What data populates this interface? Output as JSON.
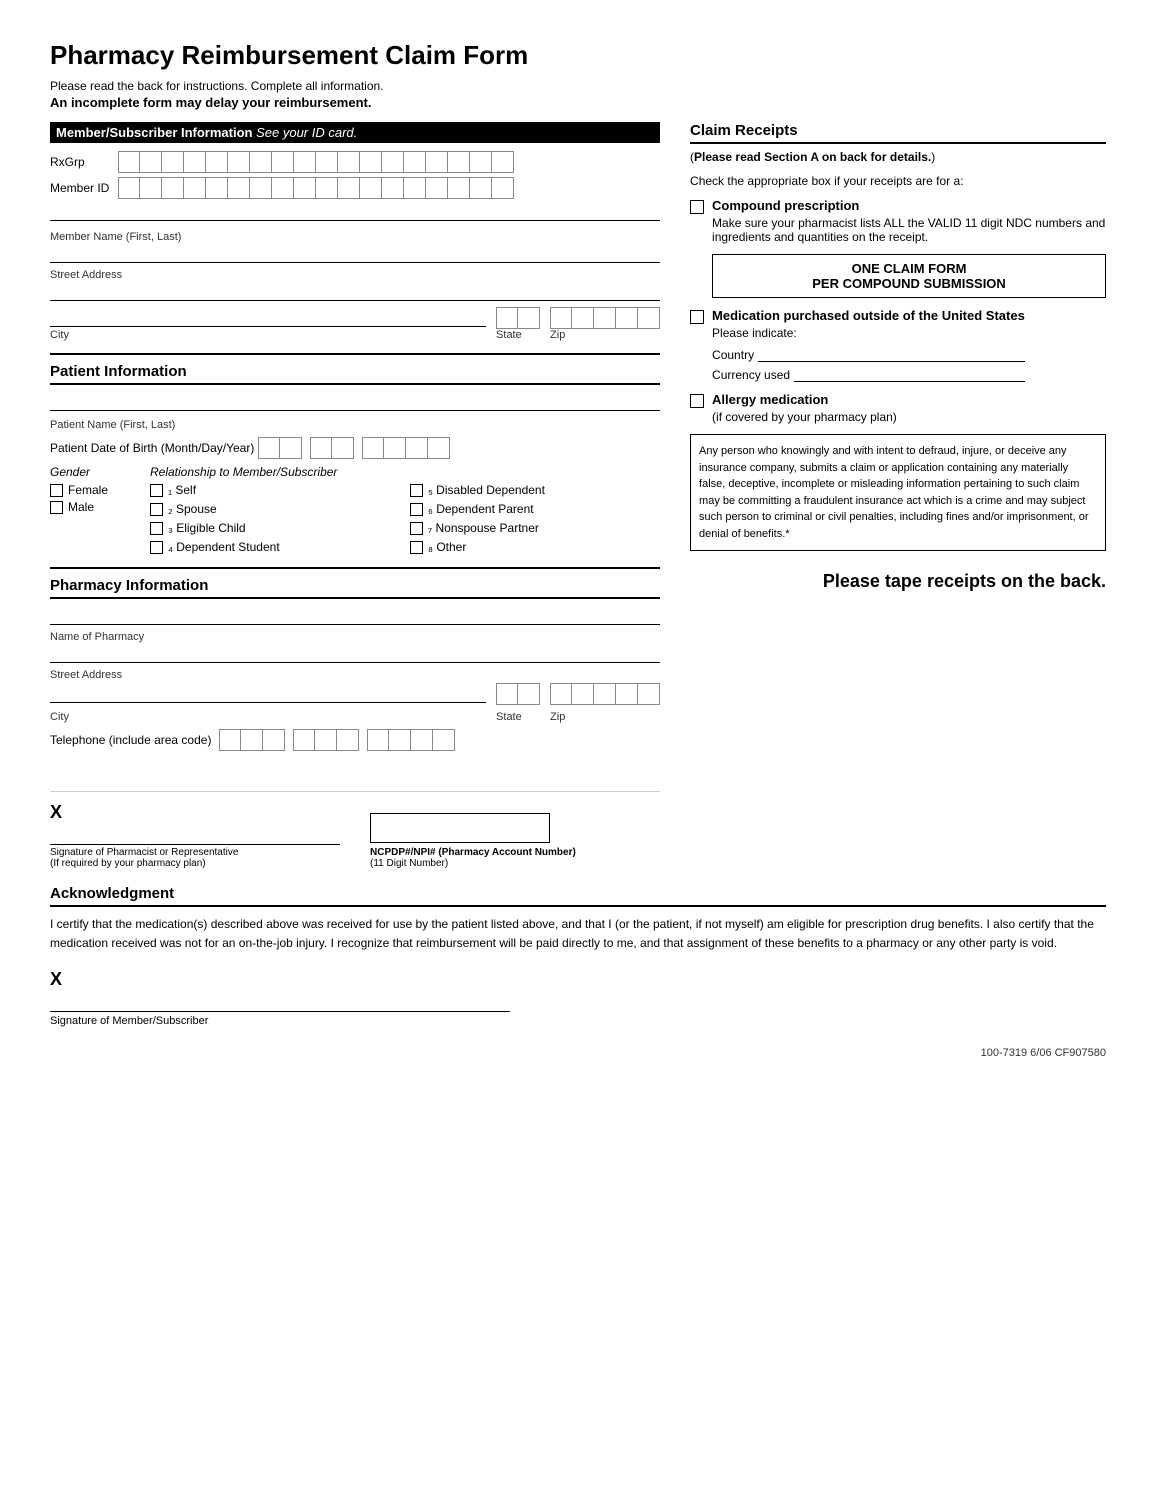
{
  "title": "Pharmacy Reimbursement Claim Form",
  "subtitle1": "Please read the back for instructions. Complete all information.",
  "subtitle2": "An incomplete form may delay your reimbursement.",
  "member_section": {
    "header": "Member/Subscriber Information",
    "header_italic": "See your ID card.",
    "rxgrp_label": "RxGrp",
    "member_id_label": "Member ID",
    "member_name_label": "Member Name (First, Last)",
    "street_address_label": "Street Address",
    "city_label": "City",
    "state_label": "State",
    "zip_label": "Zip"
  },
  "patient_section": {
    "header": "Patient Information",
    "name_label": "Patient Name (First, Last)",
    "dob_label": "Patient Date of Birth (Month/Day/Year)",
    "gender_label": "Gender",
    "rel_label": "Relationship to Member/Subscriber",
    "gender_options": [
      "Female",
      "Male"
    ],
    "rel_options": [
      {
        "num": "1",
        "text": "Self"
      },
      {
        "num": "2",
        "text": "Spouse"
      },
      {
        "num": "3",
        "text": "Eligible Child"
      },
      {
        "num": "4",
        "text": "Dependent Student"
      },
      {
        "num": "5",
        "text": "Disabled Dependent"
      },
      {
        "num": "6",
        "text": "Dependent Parent"
      },
      {
        "num": "7",
        "text": "Nonspouse Partner"
      },
      {
        "num": "8",
        "text": "Other"
      }
    ]
  },
  "pharmacy_section": {
    "header": "Pharmacy Information",
    "name_label": "Name of Pharmacy",
    "street_label": "Street Address",
    "city_label": "City",
    "state_label": "State",
    "zip_label": "Zip",
    "tel_label": "Telephone (include area code)"
  },
  "claim_receipts": {
    "title": "Claim Receipts",
    "subtitle": "(Please read Section A on back for details.)",
    "check_text": "Check the appropriate box if your receipts are for a:",
    "items": [
      {
        "id": "compound",
        "title": "Compound prescription",
        "text": "Make sure your pharmacist lists ALL the VALID 11 digit NDC numbers and ingredients and quantities on the receipt."
      },
      {
        "id": "medication-outside",
        "title": "Medication purchased outside of the United States",
        "text": "Please indicate:",
        "country_label": "Country",
        "currency_label": "Currency used"
      },
      {
        "id": "allergy",
        "title": "Allergy medication",
        "text": "(if covered by your pharmacy plan)"
      }
    ],
    "one_claim_label1": "ONE CLAIM FORM",
    "one_claim_label2": "PER COMPOUND SUBMISSION"
  },
  "fraud_text": "Any person who knowingly and with intent to defraud, injure, or deceive any insurance company, submits a claim or application containing any materially false, deceptive, incomplete or misleading information pertaining to such claim may be committing a fraudulent insurance act which is a crime and may subject such person to criminal or civil penalties, including fines and/or imprisonment, or denial of benefits.*",
  "tape_receipts": "Please tape receipts on the back.",
  "signature": {
    "x_label": "X",
    "sig_line_label": "Signature of Pharmacist or Representative",
    "sig_line_sublabel": "(If required by your pharmacy plan)",
    "ncpdp_label": "NCPDP#/NPI# (Pharmacy Account Number)",
    "ncpdp_sublabel": "(11 Digit Number)"
  },
  "acknowledgment": {
    "title": "Acknowledgment",
    "text": "I certify that the medication(s) described above was received for use by the patient listed above, and that I (or the patient, if not myself) am eligible for prescription drug benefits. I also certify that the medication received was not for an on-the-job injury. I recognize that reimbursement will be paid directly to me, and that assignment of these benefits to a pharmacy or any other party is void.",
    "member_sig_label": "Signature of Member/Subscriber",
    "x_label": "X"
  },
  "form_number": "100-7319  6/06  CF907580"
}
